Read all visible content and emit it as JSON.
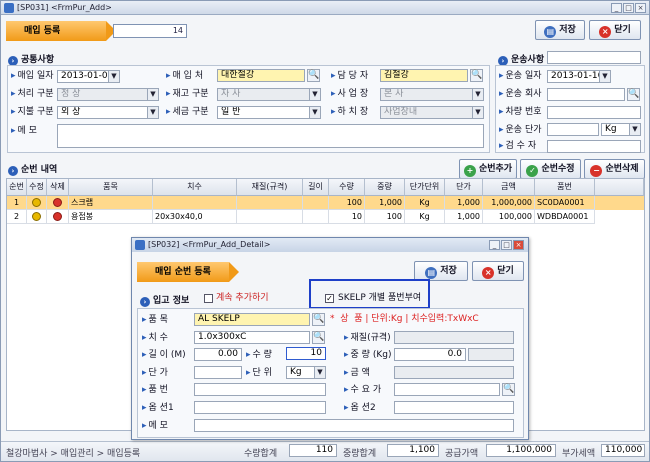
{
  "window": {
    "title": "[SP031] <FrmPur_Add>"
  },
  "header": {
    "ribbon": "매입 등록",
    "code": "14"
  },
  "toolbar": {
    "save": "저장",
    "close": "닫기"
  },
  "common": {
    "title": "공통사항",
    "purchase_date_label": "매입 일자",
    "purchase_date": "2013-01-09",
    "vendor_label": "매 입 처",
    "vendor": "대한철강",
    "manager_label": "담 당 자",
    "manager": "김철강",
    "process_label": "처리 구분",
    "process": "정 상",
    "stock_label": "재고 구분",
    "stock": "자 사",
    "biz_label": "사 업 장",
    "biz": "본 사",
    "pay_label": "지불 구분",
    "pay": "외 상",
    "tax_label": "세금 구분",
    "tax": "일 반",
    "yard_label": "하 치 장",
    "yard": "사업장내",
    "memo_label": "메 모"
  },
  "transport": {
    "title": "운송사항",
    "date_label": "운송 일자",
    "date": "2013-01-16",
    "company_label": "운송 회사",
    "car_label": "차량 번호",
    "price_label": "운송 단가",
    "unit": "Kg",
    "inspector_label": "검 수 자"
  },
  "detail": {
    "title": "순번 내역",
    "add": "순번추가",
    "edit": "순번수정",
    "delete": "순번삭제",
    "columns": [
      "순번",
      "수정",
      "삭제",
      "품목",
      "치수",
      "재질(규격)",
      "길이",
      "수량",
      "중량",
      "단가단위",
      "단가",
      "금액",
      "품번"
    ],
    "rows": [
      [
        "1",
        "",
        "",
        "스크랩",
        "",
        "",
        "",
        "100",
        "1,000",
        "Kg",
        "1,000",
        "1,000,000",
        "SC0DA0001"
      ],
      [
        "2",
        "",
        "",
        "용접봉",
        "20x30x40,0",
        "",
        "",
        "10",
        "100",
        "Kg",
        "1,000",
        "100,000",
        "WDBDA0001"
      ]
    ]
  },
  "status": {
    "breadcrumb": "철강마법사 > 매입관리 > 매입등록",
    "qty_label": "수량합계",
    "qty": "110",
    "weight_label": "중량합계",
    "weight": "1,100",
    "supply_label": "공급가액",
    "supply": "1,100,000",
    "vat_label": "부가세액",
    "vat": "110,000"
  },
  "dialog": {
    "title": "[SP032] <FrmPur_Add_Detail>",
    "ribbon": "매입 순번 등록",
    "save": "저장",
    "close": "닫기",
    "section": "입고 정보",
    "continue_label": "계속 추가하기",
    "skelp_label": "SKELP 개별 품번부여",
    "item_label": "품 목",
    "item": "AL SKELP",
    "hint": "*  상  품 | 단위:Kg | 치수입력:TxWxC",
    "size_label": "치 수",
    "size": "1.0x300xC",
    "material_label": "재질(규격)",
    "length_label": "길 이 (M)",
    "length": "0.00",
    "qty_label": "수 량",
    "qty": "10",
    "weight_label": "중 량 (Kg)",
    "weight": "0.0",
    "price_label": "단 가",
    "unit_label": "단 위",
    "unit": "Kg",
    "amount_label": "금 액",
    "partno_label": "품 번",
    "customer_label": "수 요 가",
    "opt1_label": "옵 션1",
    "opt2_label": "옵 션2",
    "memo_label": "메 모"
  },
  "colors": {
    "accent": "#f19a18",
    "selected_row": "#ffd98c",
    "highlight_box": "#1e3fc8"
  }
}
